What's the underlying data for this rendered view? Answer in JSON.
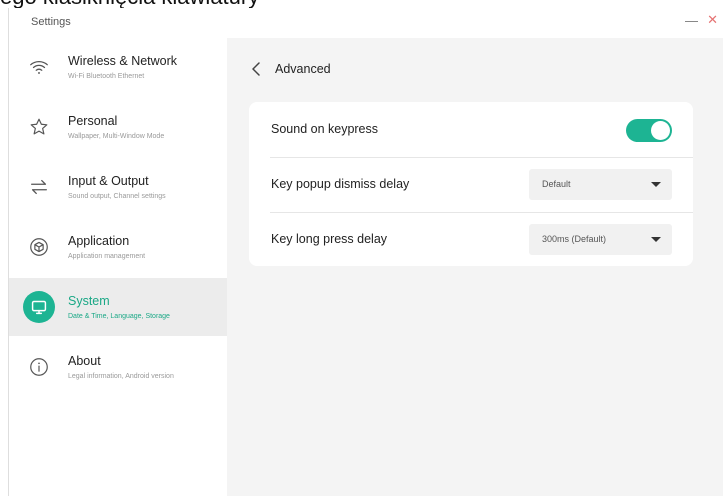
{
  "caption": "ego klasiknięcia klawiatury",
  "window": {
    "title": "Settings",
    "minimize_glyph": "—",
    "close_glyph": "✕"
  },
  "sidebar": {
    "items": [
      {
        "label": "Wireless & Network",
        "sub": "Wi-Fi Bluetooth Ethernet",
        "icon": "wifi-icon",
        "active": false
      },
      {
        "label": "Personal",
        "sub": "Wallpaper, Multi-Window Mode",
        "icon": "star-icon",
        "active": false
      },
      {
        "label": "Input & Output",
        "sub": "Sound output, Channel settings",
        "icon": "swap-arrows-icon",
        "active": false
      },
      {
        "label": "Application",
        "sub": "Application management",
        "icon": "cube-icon",
        "active": false
      },
      {
        "label": "System",
        "sub": "Date & Time, Language, Storage",
        "icon": "monitor-icon",
        "active": true
      },
      {
        "label": "About",
        "sub": "Legal information, Android version",
        "icon": "info-icon",
        "active": false
      }
    ]
  },
  "main": {
    "title": "Advanced",
    "rows": [
      {
        "label": "Sound on keypress",
        "control": "toggle",
        "on": true
      },
      {
        "label": "Key popup dismiss delay",
        "control": "select",
        "value": "Default"
      },
      {
        "label": "Key long press delay",
        "control": "select",
        "value": "300ms (Default)"
      }
    ]
  },
  "colors": {
    "accent": "#1db493",
    "close": "#e57373",
    "sidebar_active_bg": "#ececec",
    "content_bg": "#f4f4f4"
  }
}
